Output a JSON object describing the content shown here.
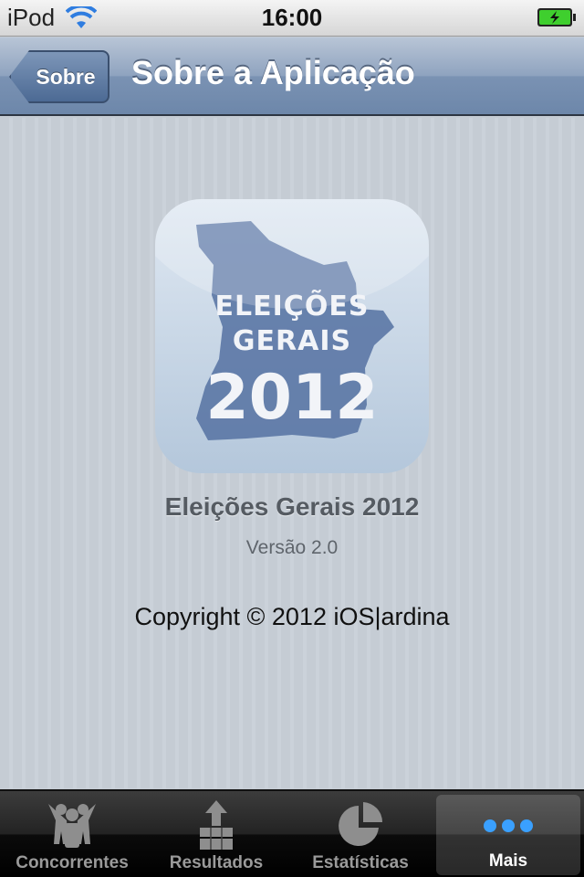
{
  "status_bar": {
    "carrier": "iPod",
    "time": "16:00",
    "icons": [
      "wifi-icon",
      "battery-icon"
    ]
  },
  "nav_bar": {
    "back_label": "Sobre",
    "title": "Sobre a Aplicação"
  },
  "app_icon": {
    "line1": "ELEIÇÕES",
    "line2": "GERAIS",
    "line3": "2012"
  },
  "about": {
    "app_name": "Eleições Gerais 2012",
    "version": "Versão 2.0",
    "copyright": "Copyright © 2012 iOS|ardina"
  },
  "tab_bar": {
    "selected": "Mais",
    "tabs": [
      {
        "label": "Concorrentes",
        "icon": "people-icon"
      },
      {
        "label": "Resultados",
        "icon": "results-upload-icon"
      },
      {
        "label": "Estatísticas",
        "icon": "pie-chart-icon"
      },
      {
        "label": "Mais",
        "icon": "more-dots-icon"
      }
    ]
  },
  "colors": {
    "nav_blue": "#6d87aa",
    "background": "#c5ccd4",
    "active_dots": "#3aa0ff"
  }
}
